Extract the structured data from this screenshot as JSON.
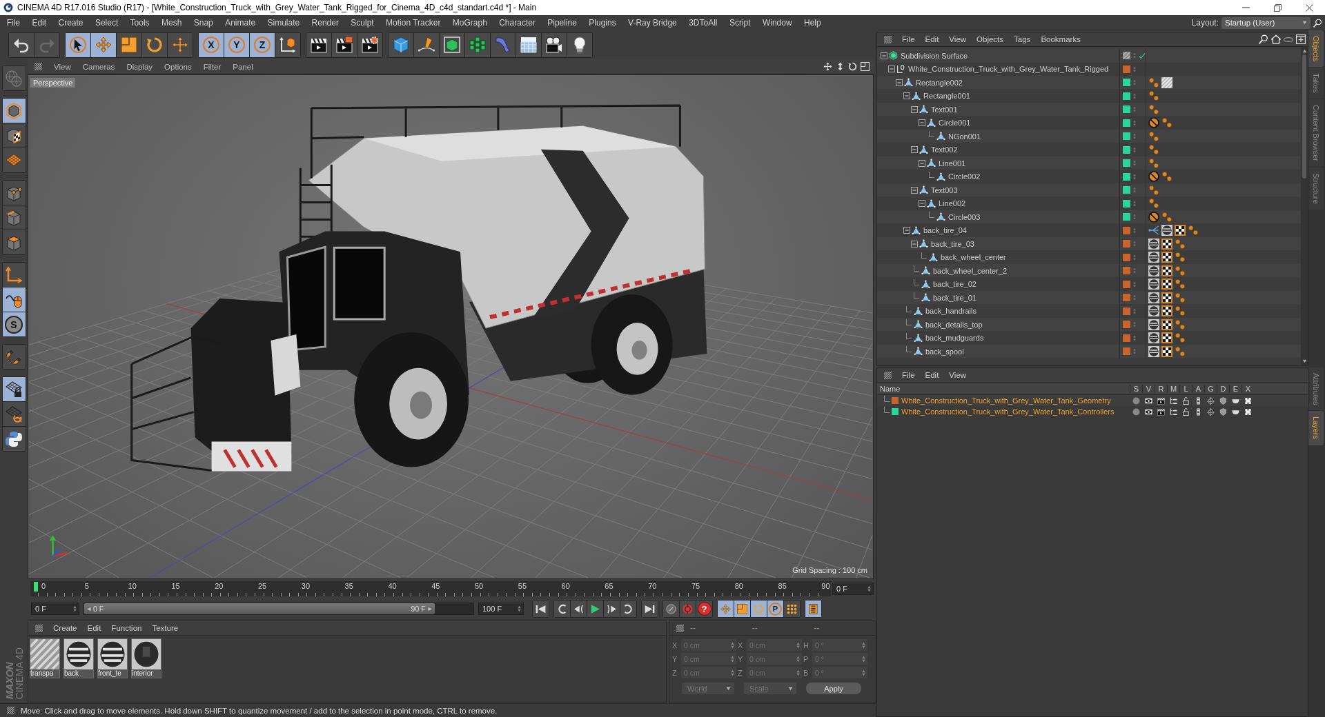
{
  "window": {
    "title": "CINEMA 4D R17.016 Studio (R17) - [White_Construction_Truck_with_Grey_Water_Tank_Rigged_for_Cinema_4D_c4d_standart.c4d *] - Main"
  },
  "menu_bar": [
    "File",
    "Edit",
    "Create",
    "Select",
    "Tools",
    "Mesh",
    "Snap",
    "Animate",
    "Simulate",
    "Render",
    "Sculpt",
    "Motion Tracker",
    "MoGraph",
    "Character",
    "Pipeline",
    "Plugins",
    "V-Ray Bridge",
    "3DToAll",
    "Script",
    "Window",
    "Help"
  ],
  "layout": {
    "label": "Layout:",
    "value": "Startup (User)"
  },
  "toolbar": [
    [
      {
        "kind": "undo",
        "selected": false,
        "disabled": false
      },
      {
        "kind": "redo",
        "selected": false,
        "disabled": true
      }
    ],
    [
      {
        "kind": "select",
        "selected": true,
        "disabled": false
      },
      {
        "kind": "move",
        "selected": true,
        "disabled": false
      },
      {
        "kind": "scale",
        "selected": false,
        "disabled": false
      },
      {
        "kind": "rotate",
        "selected": false,
        "disabled": false
      },
      {
        "kind": "transform",
        "selected": false,
        "disabled": false
      }
    ],
    [
      {
        "kind": "axis",
        "label": "X",
        "selected": true,
        "disabled": false
      },
      {
        "kind": "axis",
        "label": "Y",
        "selected": true,
        "disabled": false
      },
      {
        "kind": "axis",
        "label": "Z",
        "selected": true,
        "disabled": false
      },
      {
        "kind": "coordinates",
        "selected": false,
        "disabled": false
      }
    ],
    [
      {
        "kind": "render-view",
        "selected": false,
        "disabled": false
      },
      {
        "kind": "render-picture",
        "selected": false,
        "disabled": false
      },
      {
        "kind": "render-settings",
        "selected": false,
        "disabled": false
      }
    ],
    [
      {
        "kind": "cube",
        "selected": false,
        "disabled": false
      },
      {
        "kind": "pen",
        "selected": false,
        "disabled": false
      },
      {
        "kind": "subdivision",
        "selected": false,
        "disabled": false
      },
      {
        "kind": "cloner",
        "selected": false,
        "disabled": false
      },
      {
        "kind": "deformer",
        "selected": false,
        "disabled": false
      },
      {
        "kind": "floor",
        "selected": false,
        "disabled": false
      },
      {
        "kind": "camera",
        "selected": false,
        "disabled": false
      },
      {
        "kind": "light",
        "selected": false,
        "disabled": false
      }
    ]
  ],
  "tools": [
    [
      {
        "kind": "make-editable",
        "selected": false,
        "disabled": true
      }
    ],
    [
      {
        "kind": "model",
        "selected": true,
        "disabled": false
      },
      {
        "kind": "texture",
        "selected": false,
        "disabled": false
      },
      {
        "kind": "workplane",
        "selected": false,
        "disabled": false
      }
    ],
    [
      {
        "kind": "points",
        "selected": false,
        "disabled": false
      },
      {
        "kind": "edges",
        "selected": false,
        "disabled": false
      },
      {
        "kind": "polygons",
        "selected": false,
        "disabled": false
      }
    ],
    [
      {
        "kind": "axis-mode",
        "selected": false,
        "disabled": false
      },
      {
        "kind": "tweak",
        "selected": true,
        "disabled": false
      },
      {
        "kind": "solo",
        "label": "S",
        "selected": true,
        "disabled": false
      }
    ],
    [
      {
        "kind": "snap",
        "selected": false,
        "disabled": false
      }
    ],
    [
      {
        "kind": "lock-workplane",
        "selected": true,
        "disabled": false
      },
      {
        "kind": "workplane-rotate",
        "selected": false,
        "disabled": false
      },
      {
        "kind": "python",
        "selected": false,
        "disabled": false
      }
    ]
  ],
  "logo": {
    "brand": "MAXON",
    "product": "CINEMA 4D"
  },
  "viewport": {
    "menu": [
      "View",
      "Cameras",
      "Display",
      "Options",
      "Filter",
      "Panel"
    ],
    "camera": "Perspective",
    "grid_spacing": "Grid Spacing : 100 cm"
  },
  "timeline": {
    "ticks": [
      "0",
      "5",
      "10",
      "15",
      "20",
      "25",
      "30",
      "35",
      "40",
      "45",
      "50",
      "55",
      "60",
      "65",
      "70",
      "75",
      "80",
      "85",
      "90"
    ],
    "playhead": {
      "level": 0
    },
    "current_frame": "0 F"
  },
  "playback": {
    "start": "0 F",
    "range": {
      "level": 0.9,
      "from": "0 F",
      "to": "90 F"
    },
    "end": "100 F",
    "controls": [
      [
        {
          "kind": "go-start",
          "selected": false
        }
      ],
      [
        {
          "kind": "prev-key",
          "selected": false
        },
        {
          "kind": "prev-frame",
          "selected": false
        },
        {
          "kind": "play",
          "selected": false
        },
        {
          "kind": "next-frame",
          "selected": false
        },
        {
          "kind": "next-key",
          "selected": false
        }
      ],
      [
        {
          "kind": "go-end",
          "selected": false
        }
      ],
      [
        {
          "kind": "record",
          "selected": false
        },
        {
          "kind": "autokey",
          "selected": false
        },
        {
          "kind": "keyframe",
          "label": "?",
          "selected": false
        }
      ],
      [
        {
          "kind": "move",
          "selected": true
        },
        {
          "kind": "scale",
          "selected": true
        },
        {
          "kind": "rotate",
          "selected": true
        },
        {
          "kind": "param",
          "label": "P",
          "selected": true
        },
        {
          "kind": "points-grid",
          "selected": false
        }
      ],
      [
        {
          "kind": "timeline",
          "selected": true
        }
      ]
    ]
  },
  "materials": {
    "menu": [
      "Create",
      "Edit",
      "Function",
      "Texture"
    ],
    "items": [
      {
        "name": "transpa",
        "kind": "hatched"
      },
      {
        "name": "back",
        "kind": "textured"
      },
      {
        "name": "front_te",
        "kind": "textured"
      },
      {
        "name": "interior",
        "kind": "dark"
      }
    ]
  },
  "coordinates": {
    "disabled": true,
    "headers": [
      "--",
      "--",
      "--"
    ],
    "rows": [
      {
        "position_axis": "X",
        "position": "0 cm",
        "size_axis": "X",
        "size": "0 cm",
        "rotation_axis": "H",
        "rotation": "0 °"
      },
      {
        "position_axis": "Y",
        "position": "0 cm",
        "size_axis": "Y",
        "size": "0 cm",
        "rotation_axis": "P",
        "rotation": "0 °"
      },
      {
        "position_axis": "Z",
        "position": "0 cm",
        "size_axis": "Z",
        "size": "0 cm",
        "rotation_axis": "B",
        "rotation": "0 °"
      }
    ],
    "mode": "World",
    "size_mode": "Scale",
    "apply": "Apply"
  },
  "status_bar": "Move: Click and drag to move elements. Hold down SHIFT to quantize movement / add to the selection in point mode, CTRL to remove.",
  "object_manager": {
    "menu": [
      "File",
      "Edit",
      "View",
      "Objects",
      "Tags",
      "Bookmarks"
    ],
    "tree": [
      {
        "name": "Subdivision Surface",
        "kind": "subdivision",
        "enabled": true,
        "expanded": true,
        "children": [
          {
            "name": "White_Construction_Truck_with_Grey_Water_Tank_Rigged",
            "kind": "null",
            "color": "#c8642e",
            "expanded": true,
            "children": [
              {
                "name": "Rectangle002",
                "kind": "spline",
                "color": "#2bd69a",
                "expanded": true,
                "tags": [
                  {
                    "kind": "dots"
                  },
                  {
                    "kind": "stripes"
                  }
                ],
                "children": [
                  {
                    "name": "Rectangle001",
                    "kind": "spline",
                    "color": "#2bd69a",
                    "expanded": true,
                    "tags": [
                      {
                        "kind": "dots"
                      }
                    ],
                    "children": [
                      {
                        "name": "Text001",
                        "kind": "spline",
                        "color": "#2bd69a",
                        "expanded": true,
                        "tags": [
                          {
                            "kind": "dots"
                          }
                        ],
                        "children": [
                          {
                            "name": "Circle001",
                            "kind": "spline",
                            "color": "#2bd69a",
                            "expanded": true,
                            "tags": [
                              {
                                "kind": "protection"
                              },
                              {
                                "kind": "dots"
                              }
                            ],
                            "children": [
                              {
                                "name": "NGon001",
                                "kind": "spline",
                                "color": "#2bd69a",
                                "tags": [
                                  {
                                    "kind": "dots"
                                  }
                                ]
                              }
                            ]
                          }
                        ]
                      },
                      {
                        "name": "Text002",
                        "kind": "spline",
                        "color": "#2bd69a",
                        "expanded": true,
                        "tags": [
                          {
                            "kind": "dots"
                          }
                        ],
                        "children": [
                          {
                            "name": "Line001",
                            "kind": "spline",
                            "color": "#2bd69a",
                            "expanded": true,
                            "tags": [
                              {
                                "kind": "dots"
                              }
                            ],
                            "children": [
                              {
                                "name": "Circle002",
                                "kind": "spline",
                                "color": "#2bd69a",
                                "tags": [
                                  {
                                    "kind": "protection"
                                  },
                                  {
                                    "kind": "dots"
                                  }
                                ]
                              }
                            ]
                          }
                        ]
                      },
                      {
                        "name": "Text003",
                        "kind": "spline",
                        "color": "#2bd69a",
                        "expanded": true,
                        "tags": [
                          {
                            "kind": "dots"
                          }
                        ],
                        "children": [
                          {
                            "name": "Line002",
                            "kind": "spline",
                            "color": "#2bd69a",
                            "expanded": true,
                            "tags": [
                              {
                                "kind": "dots"
                              }
                            ],
                            "children": [
                              {
                                "name": "Circle003",
                                "kind": "spline",
                                "color": "#2bd69a",
                                "tags": [
                                  {
                                    "kind": "protection"
                                  },
                                  {
                                    "kind": "dots"
                                  }
                                ]
                              }
                            ]
                          }
                        ]
                      }
                    ]
                  },
                  {
                    "name": "back_tire_04",
                    "kind": "spline",
                    "color": "#c8642e",
                    "expanded": true,
                    "tags": [
                      {
                        "kind": "hierarchy"
                      },
                      {
                        "kind": "sphere"
                      },
                      {
                        "kind": "checker"
                      },
                      {
                        "kind": "dots"
                      }
                    ],
                    "children": [
                      {
                        "name": "back_tire_03",
                        "kind": "spline",
                        "color": "#c8642e",
                        "expanded": true,
                        "tags": [
                          {
                            "kind": "sphere"
                          },
                          {
                            "kind": "checker"
                          },
                          {
                            "kind": "dots"
                          }
                        ],
                        "children": [
                          {
                            "name": "back_wheel_center",
                            "kind": "spline",
                            "color": "#c8642e",
                            "tags": [
                              {
                                "kind": "sphere"
                              },
                              {
                                "kind": "checker"
                              },
                              {
                                "kind": "dots"
                              }
                            ]
                          }
                        ]
                      },
                      {
                        "name": "back_wheel_center_2",
                        "kind": "spline",
                        "color": "#c8642e",
                        "tags": [
                          {
                            "kind": "sphere"
                          },
                          {
                            "kind": "checker"
                          },
                          {
                            "kind": "dots"
                          }
                        ]
                      },
                      {
                        "name": "back_tire_02",
                        "kind": "spline",
                        "color": "#c8642e",
                        "tags": [
                          {
                            "kind": "sphere"
                          },
                          {
                            "kind": "checker"
                          },
                          {
                            "kind": "dots"
                          }
                        ]
                      },
                      {
                        "name": "back_tire_01",
                        "kind": "spline",
                        "color": "#c8642e",
                        "tags": [
                          {
                            "kind": "sphere"
                          },
                          {
                            "kind": "checker"
                          },
                          {
                            "kind": "dots"
                          }
                        ]
                      }
                    ]
                  },
                  {
                    "name": "back_handrails",
                    "kind": "spline",
                    "color": "#c8642e",
                    "tags": [
                      {
                        "kind": "sphere"
                      },
                      {
                        "kind": "checker"
                      },
                      {
                        "kind": "dots"
                      }
                    ]
                  },
                  {
                    "name": "back_details_top",
                    "kind": "spline",
                    "color": "#c8642e",
                    "tags": [
                      {
                        "kind": "sphere"
                      },
                      {
                        "kind": "checker"
                      },
                      {
                        "kind": "dots"
                      }
                    ]
                  },
                  {
                    "name": "back_mudguards",
                    "kind": "spline",
                    "color": "#c8642e",
                    "tags": [
                      {
                        "kind": "sphere"
                      },
                      {
                        "kind": "checker"
                      },
                      {
                        "kind": "dots"
                      }
                    ]
                  },
                  {
                    "name": "back_spool",
                    "kind": "spline",
                    "color": "#c8642e",
                    "tags": [
                      {
                        "kind": "sphere"
                      },
                      {
                        "kind": "checker"
                      },
                      {
                        "kind": "dots"
                      }
                    ]
                  }
                ]
              }
            ]
          }
        ]
      }
    ]
  },
  "layer_manager": {
    "menu": [
      "File",
      "Edit",
      "View"
    ],
    "name_header": "Name",
    "columns": [
      {
        "label": "S",
        "kind": "solo"
      },
      {
        "label": "V",
        "kind": "view"
      },
      {
        "label": "R",
        "kind": "render"
      },
      {
        "label": "M",
        "kind": "manager"
      },
      {
        "label": "L",
        "kind": "lock"
      },
      {
        "label": "A",
        "kind": "animation"
      },
      {
        "label": "G",
        "kind": "generators"
      },
      {
        "label": "D",
        "kind": "deformers"
      },
      {
        "label": "E",
        "kind": "expressions"
      },
      {
        "label": "X",
        "kind": "xref"
      }
    ],
    "layers": [
      {
        "name": "White_Construction_Truck_with_Grey_Water_Tank_Geometry",
        "color": "#c8642e"
      },
      {
        "name": "White_Construction_Truck_with_Grey_Water_Tank_Controllers",
        "color": "#2bd69a"
      }
    ]
  },
  "side_tabs": {
    "upper": [
      {
        "label": "Objects",
        "selected": true
      },
      {
        "label": "Takes",
        "selected": false
      },
      {
        "label": "Content Browser",
        "selected": false
      },
      {
        "label": "Structure",
        "selected": false
      }
    ],
    "lower": [
      {
        "label": "Attributes",
        "selected": false
      },
      {
        "label": "Layers",
        "selected": true
      }
    ]
  }
}
